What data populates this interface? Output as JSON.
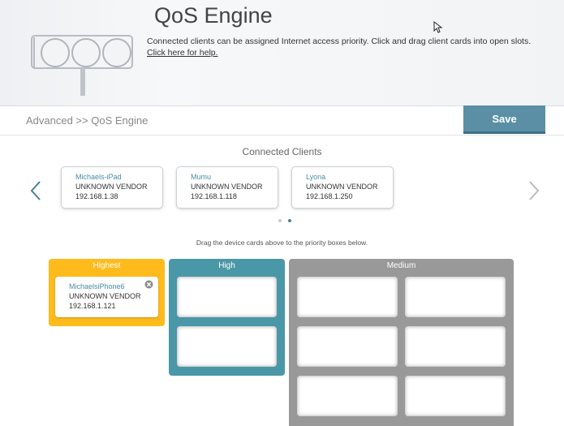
{
  "header": {
    "title": "QoS Engine",
    "description": "Connected clients can be assigned Internet access priority. Click and drag client cards into open slots.",
    "help_link": "Click here for help."
  },
  "breadcrumb": "Advanced >> QoS Engine",
  "toolbar": {
    "save_label": "Save"
  },
  "connected_clients": {
    "title": "Connected Clients",
    "cards": [
      {
        "name": "Michaels-iPad",
        "vendor": "UNKNOWN VENDOR",
        "ip": "192.168.1.38"
      },
      {
        "name": "Mumu",
        "vendor": "UNKNOWN VENDOR",
        "ip": "192.168.1.118"
      },
      {
        "name": "Lyona",
        "vendor": "UNKNOWN VENDOR",
        "ip": "192.168.1.250"
      }
    ],
    "pager": {
      "pages": 2,
      "current": 2
    }
  },
  "hint": "Drag the device cards above to the priority boxes below.",
  "priority": {
    "highest": {
      "label": "Highest",
      "color": "#ffbb1c",
      "card": {
        "name": "MichaelsiPhone6",
        "vendor": "UNKNOWN VENDOR",
        "ip": "192.168.1.121"
      }
    },
    "high": {
      "label": "High",
      "color": "#4a97a8"
    },
    "medium": {
      "label": "Medium",
      "color": "#999999"
    }
  },
  "colors": {
    "accent": "#5a8fa6",
    "link": "#4a8ca6"
  },
  "icons": [
    "traffic-light-icon",
    "chevron-left-icon",
    "chevron-right-icon",
    "close-icon",
    "cursor-icon"
  ]
}
